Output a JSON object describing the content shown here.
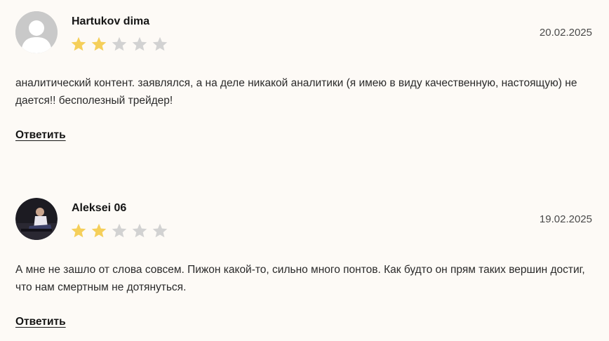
{
  "reviews": [
    {
      "author": "Hartukov dima",
      "date": "20.02.2025",
      "rating": 2,
      "max_rating": 5,
      "text": "аналитический контент. заявлялся, а на деле никакой аналитики (я имею в виду качественную, настоящую) не дается!! бесполезный трейдер!",
      "reply_label": "Ответить",
      "avatar": "default-user-icon"
    },
    {
      "author": "Aleksei 06",
      "date": "19.02.2025",
      "rating": 2,
      "max_rating": 5,
      "text": "А мне не зашло от слова совсем. Пижон какой-то, сильно много понтов. Как будто он прям таких вершин достиг, что нам смертным не дотянуться.",
      "reply_label": "Ответить",
      "avatar": "user-photo"
    }
  ],
  "colors": {
    "background": "#fdfaf6",
    "star_filled": "#f5cf5a",
    "star_empty": "#d2d2d2",
    "avatar_placeholder": "#c9c9c9"
  }
}
